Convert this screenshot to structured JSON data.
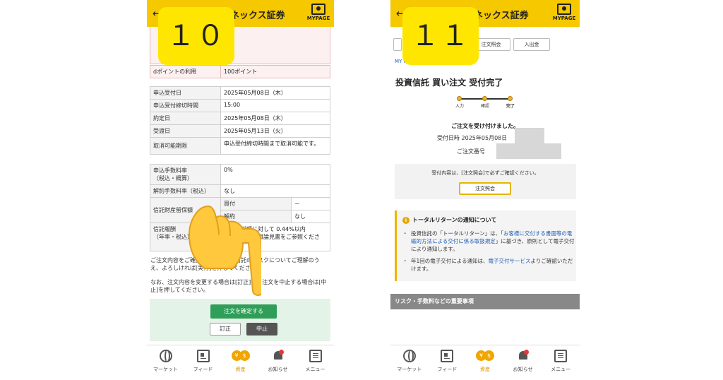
{
  "left": {
    "step": "１０",
    "header": {
      "logo": "ネックス証券",
      "mypage": "MYPAGE"
    },
    "point_row": {
      "key": "dポイントの利用",
      "value": "100ポイント"
    },
    "dates": [
      {
        "key": "申込受付日",
        "value": "2025年05月08日（木）"
      },
      {
        "key": "申込受付締切時間",
        "value": "15:00"
      },
      {
        "key": "約定日",
        "value": "2025年05月08日（木）"
      },
      {
        "key": "受渡日",
        "value": "2025年05月13日（火）"
      },
      {
        "key": "取消可能期限",
        "value": "申込受付締切時間まで取消可能です。"
      }
    ],
    "fees": {
      "fee_key": "申込手数料率\n（税込・概算）",
      "fee_value": "0%",
      "cancel_key": "解約手数料率（税込）",
      "cancel_value": "なし",
      "trust_key": "信託財産留保額",
      "buy_label": "買付",
      "buy_value": "－",
      "sell_label": "解約",
      "sell_value": "なし",
      "reward_key": "信託報酬\n（年率・税込）",
      "reward_value": "純資産総額に対して 0.44%以内\nもしくは交付目論見書をご参照ください。"
    },
    "notice1": "ご注文内容をご確認のうえ、投資信託のリスクについてご理解のうえ、よろしければ[実行]を押してください。",
    "notice2": "なお、注文内容を変更する場合は[訂正]を、注文を中止する場合は[中止]を押してください。",
    "buttons": {
      "confirm": "注文を確定する",
      "correct": "訂正",
      "cancel": "中止"
    }
  },
  "right": {
    "step": "１１",
    "header": {
      "logo": "ネックス証券",
      "mypage": "MYPAGE"
    },
    "tabs": [
      "注文照会",
      "入出金"
    ],
    "mypage_link": "MY PAGE",
    "title": "投資信託 買い注文 受付完了",
    "progress": [
      "入力",
      "確認",
      "完了"
    ],
    "done_msg": "ご注文を受け付けました。",
    "received_at": "受付日時 2025年05月08日",
    "order_no": "ご注文番号",
    "confirm_msg": "受付内容は、[注文照会]で必ずご確認ください。",
    "confirm_btn": "注文照会",
    "info": {
      "title": "トータルリターンの通知について",
      "b1_pre": "投資信託の「トータルリターン」は、「",
      "b1_link": "お客様に交付する書面等の電磁的方法による交付に係る取扱規定",
      "b1_post": "」に基づき、原則として電子交付により通知します。",
      "b2_pre": "年1回の電子交付による通知は、",
      "b2_link": "電子交付サービス",
      "b2_post": "よりご確認いただけます。"
    },
    "section": "リスク・手数料などの重要事項"
  },
  "nav": [
    {
      "label": "マーケット",
      "icon": "globe-icon"
    },
    {
      "label": "フィード",
      "icon": "feed-icon"
    },
    {
      "label": "資産",
      "icon": "asset-icon"
    },
    {
      "label": "お知らせ",
      "icon": "bell-icon"
    },
    {
      "label": "メニュー",
      "icon": "menu-icon"
    }
  ]
}
